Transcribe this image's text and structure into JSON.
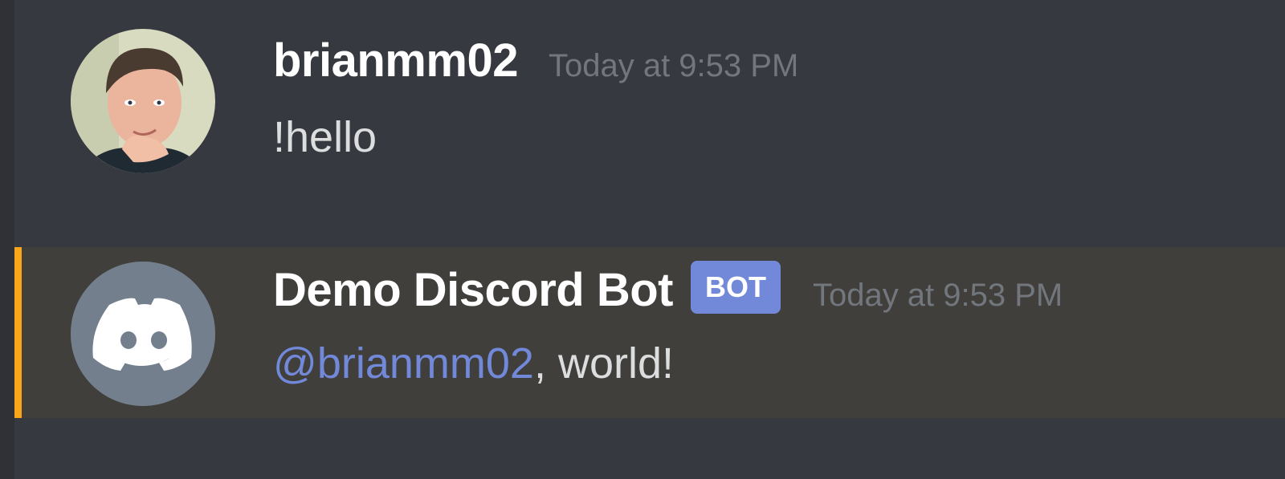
{
  "messages": [
    {
      "author": "brianmm02",
      "timestamp": "Today at 9:53 PM",
      "content": "!hello",
      "avatar": "user-photo"
    },
    {
      "author": "Demo Discord Bot",
      "badge": "BOT",
      "timestamp": "Today at 9:53 PM",
      "mention": "@brianmm02",
      "content_suffix": ", world!",
      "avatar": "discord-logo-icon",
      "highlighted": true
    }
  ],
  "colors": {
    "background": "#36393f",
    "mention_highlight": "#413f3c",
    "mention_bar": "#faa61a",
    "blurple": "#7289da",
    "timestamp": "#72767d",
    "text": "#dcddde",
    "avatar_bot_bg": "#747f8d"
  }
}
